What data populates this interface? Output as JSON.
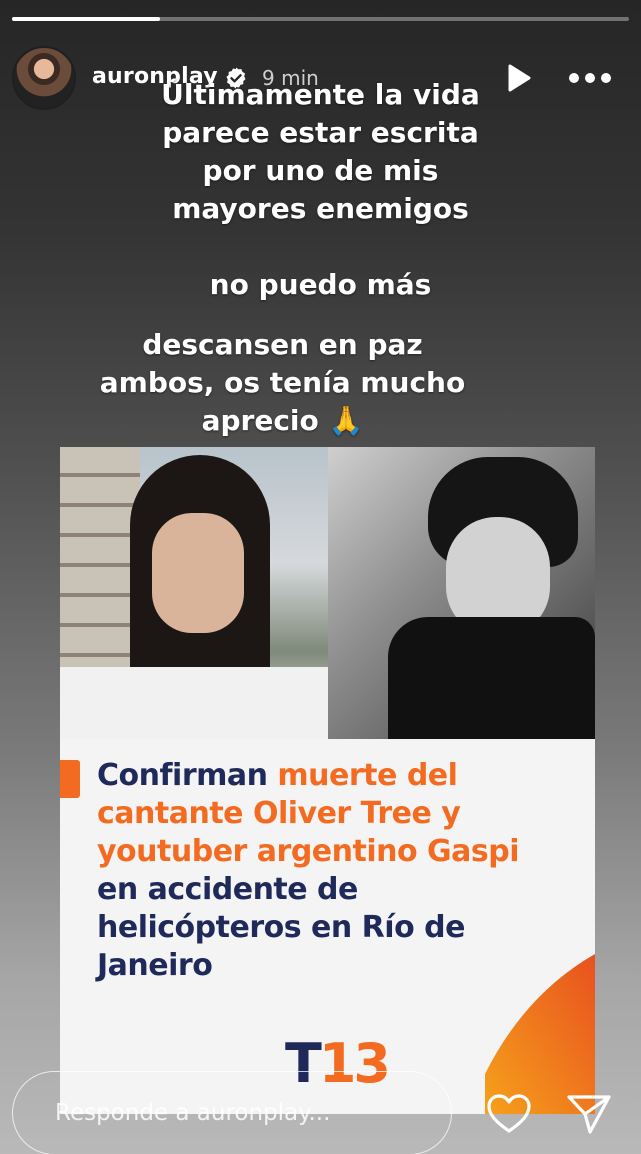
{
  "progress": {
    "fraction": 0.24
  },
  "header": {
    "username": "auronplay",
    "time": "9 min",
    "avatar_icon": "profile-avatar",
    "verified_icon": "verified-badge-icon",
    "play_icon": "play-icon",
    "more_icon": "more-options-icon"
  },
  "caption": {
    "line1": "Últimamente la vida parece estar escrita por uno de mis mayores enemigos",
    "line2": "no puedo más",
    "line3": "descansen en paz ambos, os tenía mucho aprecio",
    "emoji": "🙏"
  },
  "post": {
    "headline_part1": "Confirman ",
    "headline_part2": "muerte del cantante Oliver Tree y youtuber argentino Gaspi",
    "headline_part3": " en accidente de helicópteros en Río de Janeiro",
    "logo_t": "T",
    "logo_num": "13"
  },
  "reply": {
    "placeholder": "Responde a auronplay..."
  },
  "colors": {
    "accent_orange": "#f26b21",
    "navy": "#1f2a5a"
  }
}
